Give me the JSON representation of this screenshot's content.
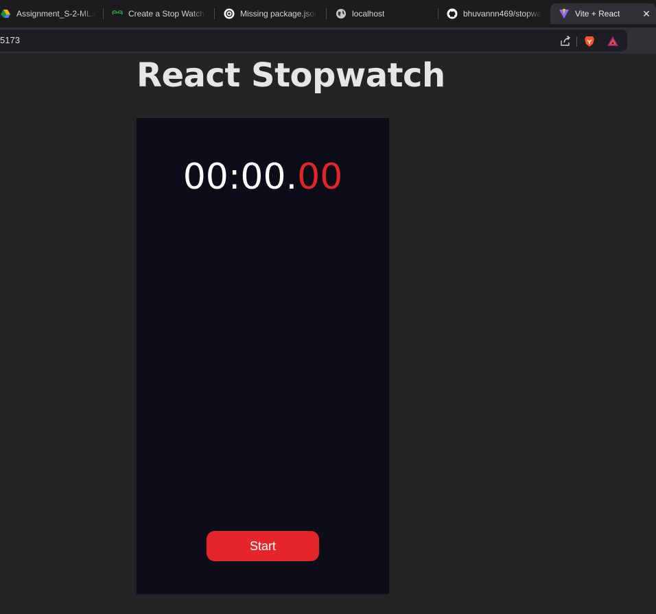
{
  "browser": {
    "tabs": [
      {
        "label": "Assignment_S-2-ML.c",
        "icon": "google-drive-icon",
        "active": false
      },
      {
        "label": "Create a Stop Watch u",
        "icon": "geeksforgeeks-icon",
        "active": false
      },
      {
        "label": "Missing package.json",
        "icon": "chatgpt-icon",
        "active": false
      },
      {
        "label": "localhost",
        "icon": "globe-icon",
        "active": false
      },
      {
        "label": "bhuvannn469/stopwa",
        "icon": "github-icon",
        "active": false
      },
      {
        "label": "Vite + React",
        "icon": "vite-icon",
        "active": true
      }
    ],
    "close_symbol": "✕",
    "url": "5173"
  },
  "page": {
    "title": "React Stopwatch",
    "stopwatch": {
      "main_time": "00:00.",
      "centiseconds": "00",
      "start_label": "Start"
    }
  },
  "colors": {
    "accent": "#e4262b",
    "panel": "#0d0d19",
    "background": "#242424"
  }
}
